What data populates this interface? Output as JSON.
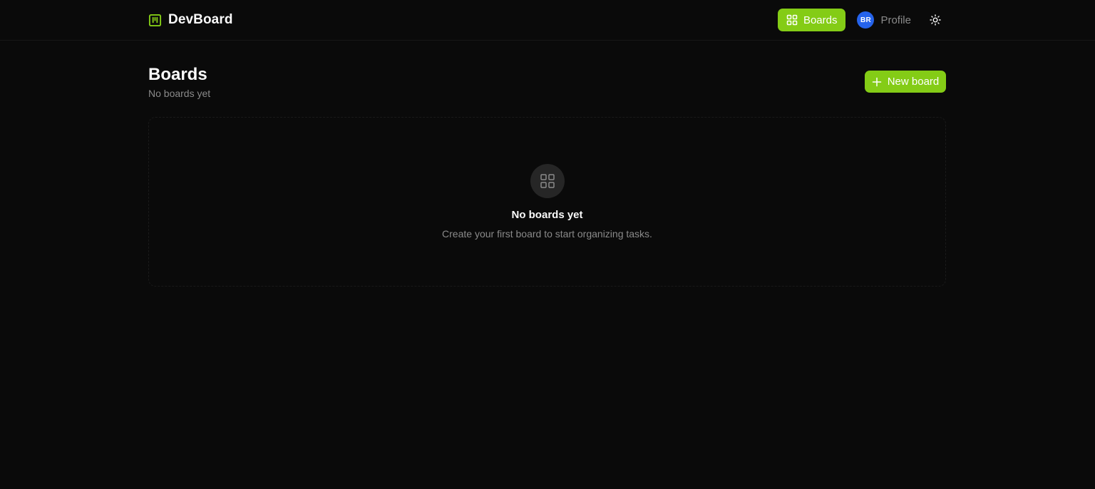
{
  "app": {
    "name": "DevBoard",
    "logo_icon": "kanban-icon",
    "accent_color": "#84cc16"
  },
  "nav": {
    "boards_label": "Boards",
    "boards_icon": "grid-icon",
    "profile_initials": "BR",
    "profile_label": "Profile",
    "theme_icon": "sun-icon"
  },
  "page": {
    "title": "Boards",
    "subtitle": "No boards yet",
    "new_board_label": "New board"
  },
  "empty_state": {
    "icon": "grid-icon",
    "title": "No boards yet",
    "description": "Create your first board to start organizing tasks."
  }
}
